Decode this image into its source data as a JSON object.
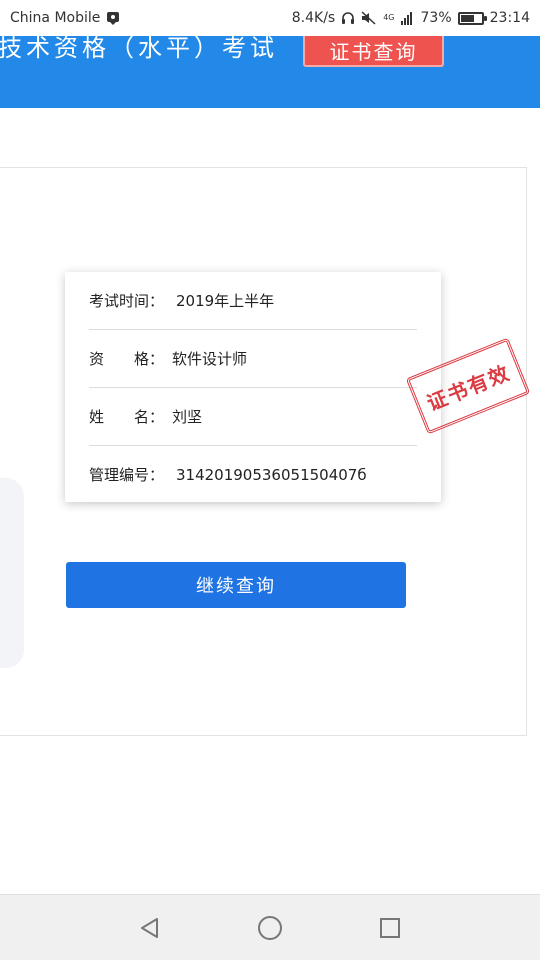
{
  "status_bar": {
    "carrier": "China Mobile",
    "speed": "8.4K/s",
    "network": "4G",
    "battery_percent": "73%",
    "battery_level": 0.73,
    "time": "23:14",
    "icons": [
      "notification-icon",
      "headphone-icon",
      "mute-icon",
      "signal-icon",
      "battery-icon"
    ]
  },
  "header": {
    "title": "技术资格（水平）考试",
    "cert_query_label": "证书查询",
    "colors": {
      "background": "#2389e8",
      "button": "#ef5350"
    }
  },
  "certificate": {
    "rows": [
      {
        "label": "考试时间：",
        "value": "2019年上半年"
      },
      {
        "label": "资　　格：",
        "value": "软件设计师"
      },
      {
        "label": "姓　　名：",
        "value": "刘坚"
      },
      {
        "label": "管理编号：",
        "value": "3142019053605150407б"
      }
    ],
    "stamp_text": "证书有效",
    "stamp_color": "#d8262e"
  },
  "actions": {
    "continue_label": "继续查询",
    "continue_color": "#1f73e3"
  },
  "nav_bar": {
    "icons": [
      "back-icon",
      "home-icon",
      "recents-icon"
    ]
  }
}
